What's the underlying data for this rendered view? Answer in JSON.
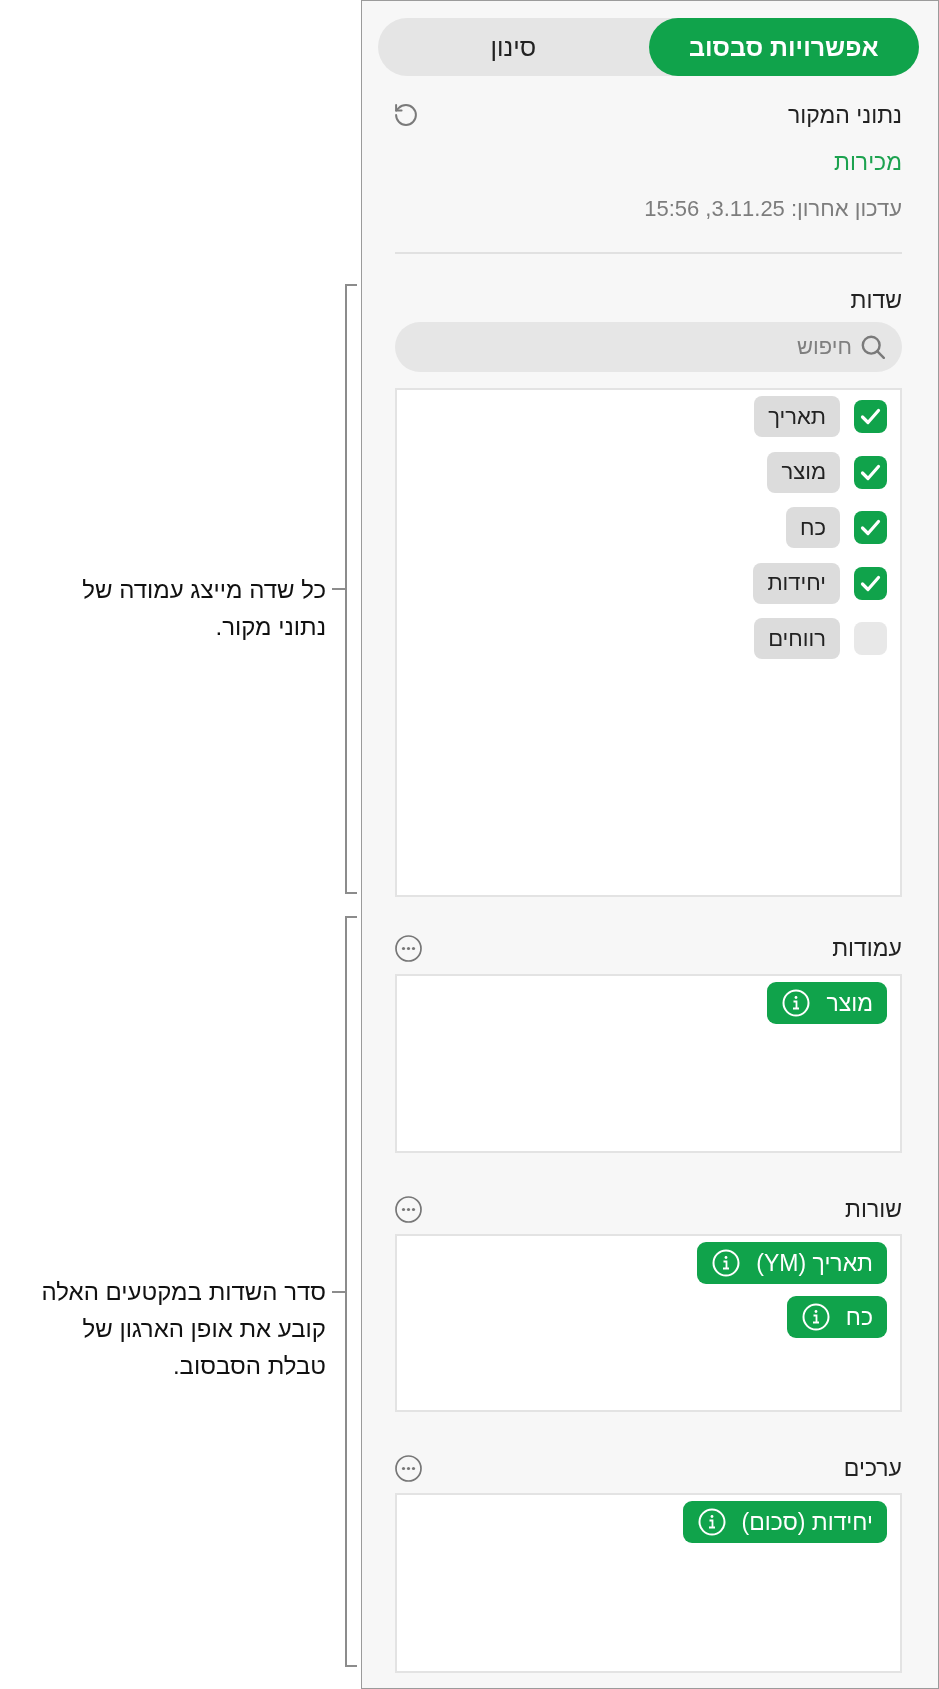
{
  "tabs": [
    {
      "label": "אפשרויות סבסוב",
      "selected": true
    },
    {
      "label": "סינון",
      "selected": false
    }
  ],
  "source": {
    "title": "נתוני המקור",
    "name": "מכירות",
    "updated": "עדכון אחרון: 3.11.25, 15:56"
  },
  "fields": {
    "title": "שדות",
    "search": {
      "placeholder": "חיפוש"
    },
    "items": [
      {
        "label": "תאריך",
        "checked": true
      },
      {
        "label": "מוצר",
        "checked": true
      },
      {
        "label": "כח",
        "checked": true
      },
      {
        "label": "יחידות",
        "checked": true
      },
      {
        "label": "רווחים",
        "checked": false
      }
    ]
  },
  "sections": [
    {
      "title": "עמודות",
      "items": [
        {
          "label": "מוצר"
        }
      ]
    },
    {
      "title": "שורות",
      "items": [
        {
          "label": "תאריך (YM)"
        },
        {
          "label": "כח"
        }
      ]
    },
    {
      "title": "ערכים",
      "items": [
        {
          "label": "יחידות (סכום)"
        }
      ]
    }
  ],
  "callouts": [
    {
      "text": "כל שדה מייצג עמודה של נתוני מקור."
    },
    {
      "text": "סדר השדות במקטעים האלה קובע את אופן הארגון של טבלת הסבסוב."
    }
  ]
}
